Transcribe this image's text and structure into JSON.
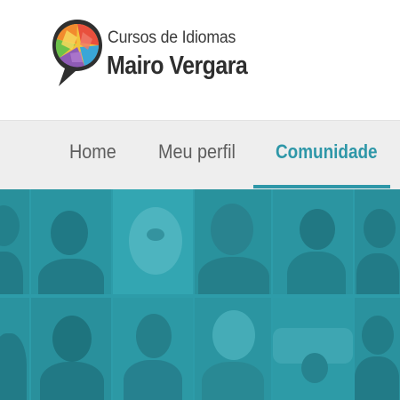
{
  "brand": {
    "subtitle": "Cursos de Idiomas",
    "name": "Mairo Vergara",
    "logo_icon": "speech-bubble-globe-logo",
    "logo_colors": [
      "#f2c33b",
      "#e94f3d",
      "#6cc24a",
      "#3aa6d8",
      "#f28a2e",
      "#8e5bb5"
    ]
  },
  "nav": {
    "items": [
      {
        "label": "Home",
        "active": false
      },
      {
        "label": "Meu perfil",
        "active": false
      },
      {
        "label": "Comunidade",
        "active": true
      }
    ],
    "active_color": "#2e97a8"
  },
  "banner": {
    "description_icon": "community-photo-grid",
    "tint_color": "#2d9ca9"
  }
}
